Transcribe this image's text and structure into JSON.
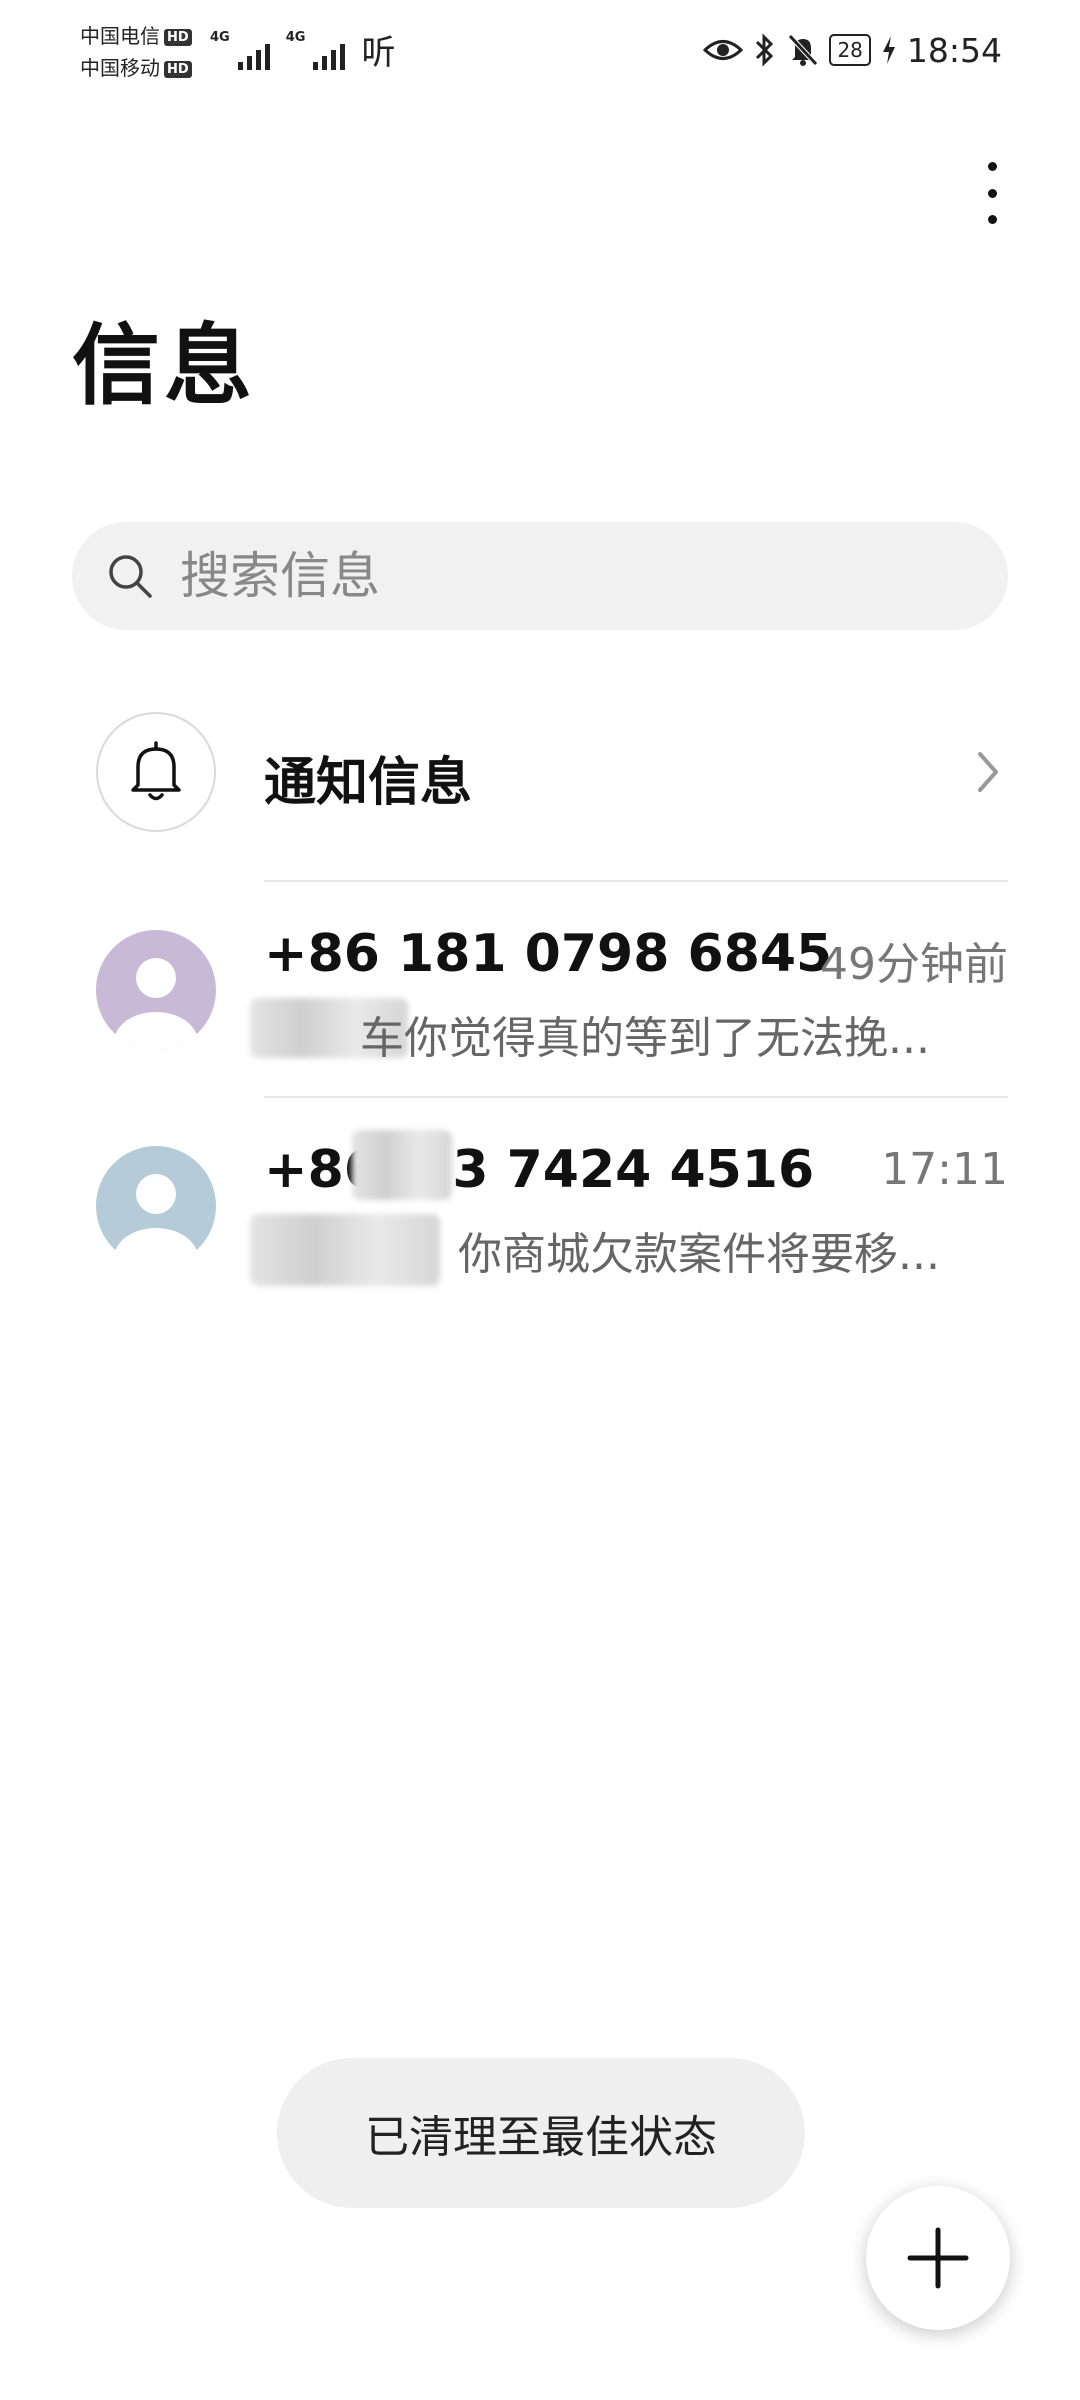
{
  "status_bar": {
    "carrier_1": "中国电信",
    "carrier_2": "中国移动",
    "hd": "HD",
    "network_1": "4G",
    "network_2": "4G",
    "listen": "听",
    "battery": "28",
    "time": "18:54"
  },
  "header": {
    "title": "信息"
  },
  "search": {
    "placeholder": "搜索信息"
  },
  "notification_row": {
    "label": "通知信息"
  },
  "conversations": [
    {
      "name": "+86 181 0798 6845",
      "time": "49分钟前",
      "snippet": "车你觉得真的等到了无法挽..."
    },
    {
      "name": "+86 1  3 7424 4516",
      "time": "17:11",
      "snippet": "你商城欠款案件将要移..."
    }
  ],
  "toast": {
    "text": "已清理至最佳状态"
  },
  "colors": {
    "avatar_1": "#c8b9d6",
    "avatar_2": "#b5cbd8",
    "background": "#ffffff"
  }
}
